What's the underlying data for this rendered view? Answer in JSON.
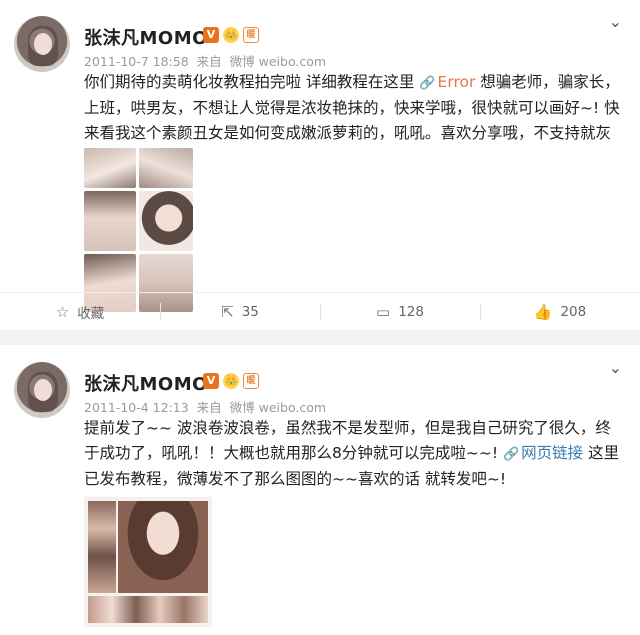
{
  "posts": [
    {
      "author": "张沫凡MOMO",
      "badges": [
        "V",
        "👑",
        "暖"
      ],
      "date": "2011-10-7 18:58",
      "source_prefix": "来自",
      "source": "微博 weibo.com",
      "text_before": "你们期待的卖萌化妆教程拍完啦 详细教程在这里 ",
      "link_icon": "🔗",
      "link_text": "Error",
      "text_after": " 想骗老师，骗家长，上班，哄男友，不想让人觉得是浓妆艳抹的，快来学哦，很快就可以画好~! 快来看我这个素颜丑女是如何变成嫩派萝莉的，吼吼。喜欢分享哦，不支持就灰心了！",
      "actions": {
        "favorite": "收藏",
        "repost": "35",
        "comment": "128",
        "like": "208"
      }
    },
    {
      "author": "张沫凡MOMO",
      "badges": [
        "V",
        "👑",
        "暖"
      ],
      "date": "2011-10-4 12:13",
      "source_prefix": "来自",
      "source": "微博 weibo.com",
      "text_before": "提前发了~~ 波浪卷波浪卷，虽然我不是发型师，但是我自己研究了很久，终于成功了，吼吼！！大概也就用那么8分钟就可以完成啦~~! ",
      "link_icon": "🔗",
      "link_text": "网页链接",
      "text_after": " 这里已发布教程，微薄发不了那么图图的~~喜欢的话 就转发吧~!"
    }
  ],
  "colors": {
    "orange_link": "#eb7350",
    "blue_link": "#3b7bb0",
    "verified": "#e8731c"
  }
}
